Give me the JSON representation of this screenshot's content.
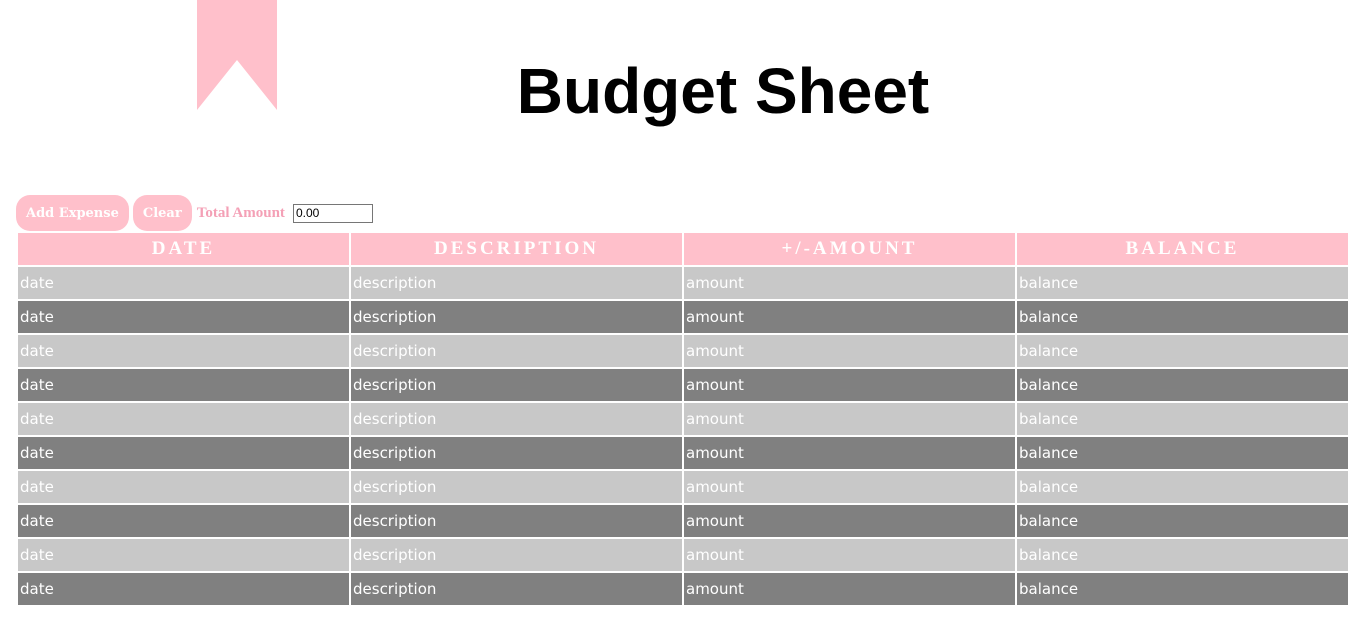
{
  "colors": {
    "accent": "#ffc0cb",
    "accent_text": "#f4a0b6",
    "row_light": "#c8c8c8",
    "row_dark": "#808080"
  },
  "icons": {
    "ribbon": "bookmark-ribbon-icon"
  },
  "header": {
    "title": "Budget Sheet"
  },
  "toolbar": {
    "add_label": "Add Expense",
    "clear_label": "Clear",
    "total_label": "Total Amount",
    "total_value": "0.00"
  },
  "table": {
    "columns": [
      "DATE",
      "DESCRIPTION",
      "+/-AMOUNT",
      "BALANCE"
    ],
    "rows": [
      [
        "date",
        "description",
        "amount",
        "balance"
      ],
      [
        "date",
        "description",
        "amount",
        "balance"
      ],
      [
        "date",
        "description",
        "amount",
        "balance"
      ],
      [
        "date",
        "description",
        "amount",
        "balance"
      ],
      [
        "date",
        "description",
        "amount",
        "balance"
      ],
      [
        "date",
        "description",
        "amount",
        "balance"
      ],
      [
        "date",
        "description",
        "amount",
        "balance"
      ],
      [
        "date",
        "description",
        "amount",
        "balance"
      ],
      [
        "date",
        "description",
        "amount",
        "balance"
      ],
      [
        "date",
        "description",
        "amount",
        "balance"
      ]
    ]
  }
}
